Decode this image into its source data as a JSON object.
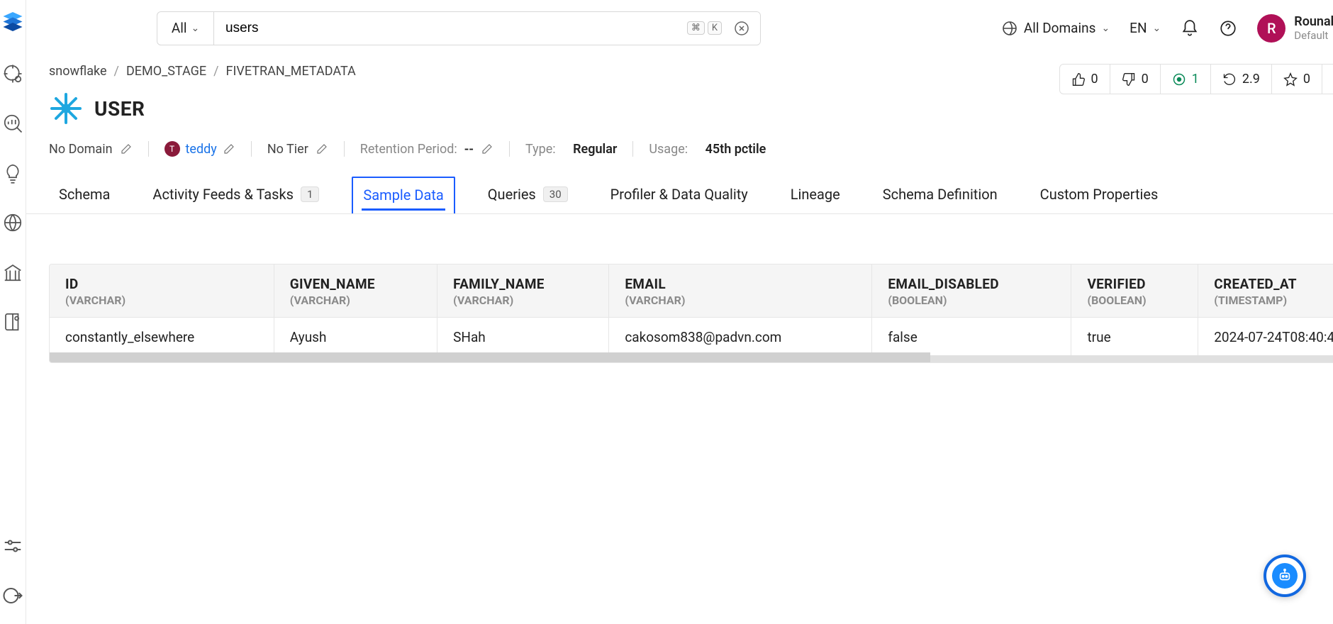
{
  "search": {
    "filter": "All",
    "value": "users",
    "shortcut": [
      "⌘",
      "K"
    ]
  },
  "topbar": {
    "domains": "All Domains",
    "lang": "EN",
    "user": {
      "initial": "R",
      "name": "Rounakpreet.d",
      "sub": "Default"
    }
  },
  "breadcrumb": [
    "snowflake",
    "DEMO_STAGE",
    "FIVETRAN_METADATA"
  ],
  "page_title": "USER",
  "stats": {
    "like": "0",
    "dislike": "0",
    "tests": "1",
    "runtime": "2.9",
    "star": "0"
  },
  "meta": {
    "domain": "No Domain",
    "owner_initial": "T",
    "owner": "teddy",
    "tier": "No Tier",
    "retention_label": "Retention Period:",
    "retention_value": "--",
    "type_label": "Type:",
    "type_value": "Regular",
    "usage_label": "Usage:",
    "usage_value": "45th pctile"
  },
  "tabs": [
    {
      "label": "Schema"
    },
    {
      "label": "Activity Feeds & Tasks",
      "badge": "1"
    },
    {
      "label": "Sample Data",
      "active": true
    },
    {
      "label": "Queries",
      "badge": "30"
    },
    {
      "label": "Profiler & Data Quality"
    },
    {
      "label": "Lineage"
    },
    {
      "label": "Schema Definition"
    },
    {
      "label": "Custom Properties"
    }
  ],
  "columns": [
    {
      "name": "ID",
      "type": "(VARCHAR)"
    },
    {
      "name": "GIVEN_NAME",
      "type": "(VARCHAR)"
    },
    {
      "name": "FAMILY_NAME",
      "type": "(VARCHAR)"
    },
    {
      "name": "EMAIL",
      "type": "(VARCHAR)"
    },
    {
      "name": "EMAIL_DISABLED",
      "type": "(BOOLEAN)"
    },
    {
      "name": "VERIFIED",
      "type": "(BOOLEAN)"
    },
    {
      "name": "CREATED_AT",
      "type": "(TIMESTAMP)"
    }
  ],
  "rows": [
    {
      "ID": "constantly_elsewhere",
      "GIVEN_NAME": "Ayush",
      "FAMILY_NAME": "SHah",
      "EMAIL": "cakosom838@padvn.com",
      "EMAIL_DISABLED": "false",
      "VERIFIED": "true",
      "CREATED_AT": "2024-07-24T08:40:4"
    }
  ]
}
